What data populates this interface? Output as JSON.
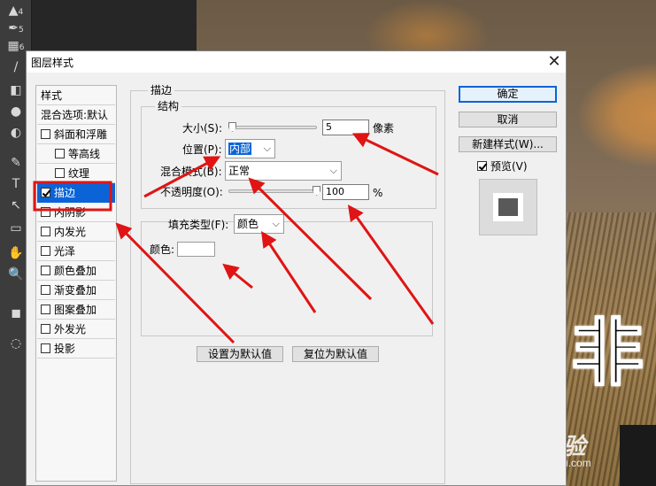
{
  "toolbar": {
    "items": [
      {
        "glyph": "▲",
        "badge": "4"
      },
      {
        "glyph": "✒",
        "badge": "5"
      },
      {
        "glyph": "▦",
        "badge": "6"
      },
      {
        "glyph": "/",
        "badge": ""
      },
      {
        "glyph": "◧",
        "badge": ""
      },
      {
        "glyph": "●",
        "badge": ""
      },
      {
        "glyph": "◐",
        "badge": ""
      },
      {
        "glyph": "✎",
        "badge": ""
      },
      {
        "glyph": "T",
        "badge": ""
      },
      {
        "glyph": "↖",
        "badge": ""
      },
      {
        "glyph": "▭",
        "badge": ""
      },
      {
        "glyph": "✋",
        "badge": ""
      },
      {
        "glyph": "🔍",
        "badge": ""
      },
      {
        "glyph": "◼",
        "badge": ""
      },
      {
        "glyph": "◌",
        "badge": ""
      }
    ]
  },
  "photo": {
    "overlay_char": "非",
    "watermark_main": "Bai 经验",
    "watermark_sub": "jingyan.baidu.com"
  },
  "dialog": {
    "title": "图层样式",
    "close_glyph": "✕",
    "styles_header": "样式",
    "blend_options": "混合选项:默认",
    "effects": [
      {
        "label": "斜面和浮雕",
        "checked": false,
        "indent": false
      },
      {
        "label": "等高线",
        "checked": false,
        "indent": true
      },
      {
        "label": "纹理",
        "checked": false,
        "indent": true
      },
      {
        "label": "描边",
        "checked": true,
        "indent": false,
        "selected": true
      },
      {
        "label": "内阴影",
        "checked": false,
        "indent": false
      },
      {
        "label": "内发光",
        "checked": false,
        "indent": false
      },
      {
        "label": "光泽",
        "checked": false,
        "indent": false
      },
      {
        "label": "颜色叠加",
        "checked": false,
        "indent": false
      },
      {
        "label": "渐变叠加",
        "checked": false,
        "indent": false
      },
      {
        "label": "图案叠加",
        "checked": false,
        "indent": false
      },
      {
        "label": "外发光",
        "checked": false,
        "indent": false
      },
      {
        "label": "投影",
        "checked": false,
        "indent": false
      }
    ],
    "stroke": {
      "group_title": "描边",
      "structure_title": "结构",
      "size_label": "大小(S):",
      "size_value": "5",
      "size_unit": "像素",
      "position_label": "位置(P):",
      "position_value": "内部",
      "blend_mode_label": "混合模式(B):",
      "blend_mode_value": "正常",
      "opacity_label": "不透明度(O):",
      "opacity_value": "100",
      "opacity_unit": "%",
      "fill_type_label": "填充类型(F):",
      "fill_type_value": "颜色",
      "color_label": "颜色:",
      "color_value": "#ffffff",
      "set_default_button": "设置为默认值",
      "reset_default_button": "复位为默认值"
    },
    "buttons": {
      "ok": "确定",
      "cancel": "取消",
      "new_style": "新建样式(W)...",
      "preview_label": "预览(V)",
      "preview_checked": true
    }
  },
  "colors": {
    "accent": "#0a64d8",
    "annotation_red": "#e01414",
    "dialog_bg": "#f0f0f0",
    "ps_dark": "#3c3c3c"
  }
}
